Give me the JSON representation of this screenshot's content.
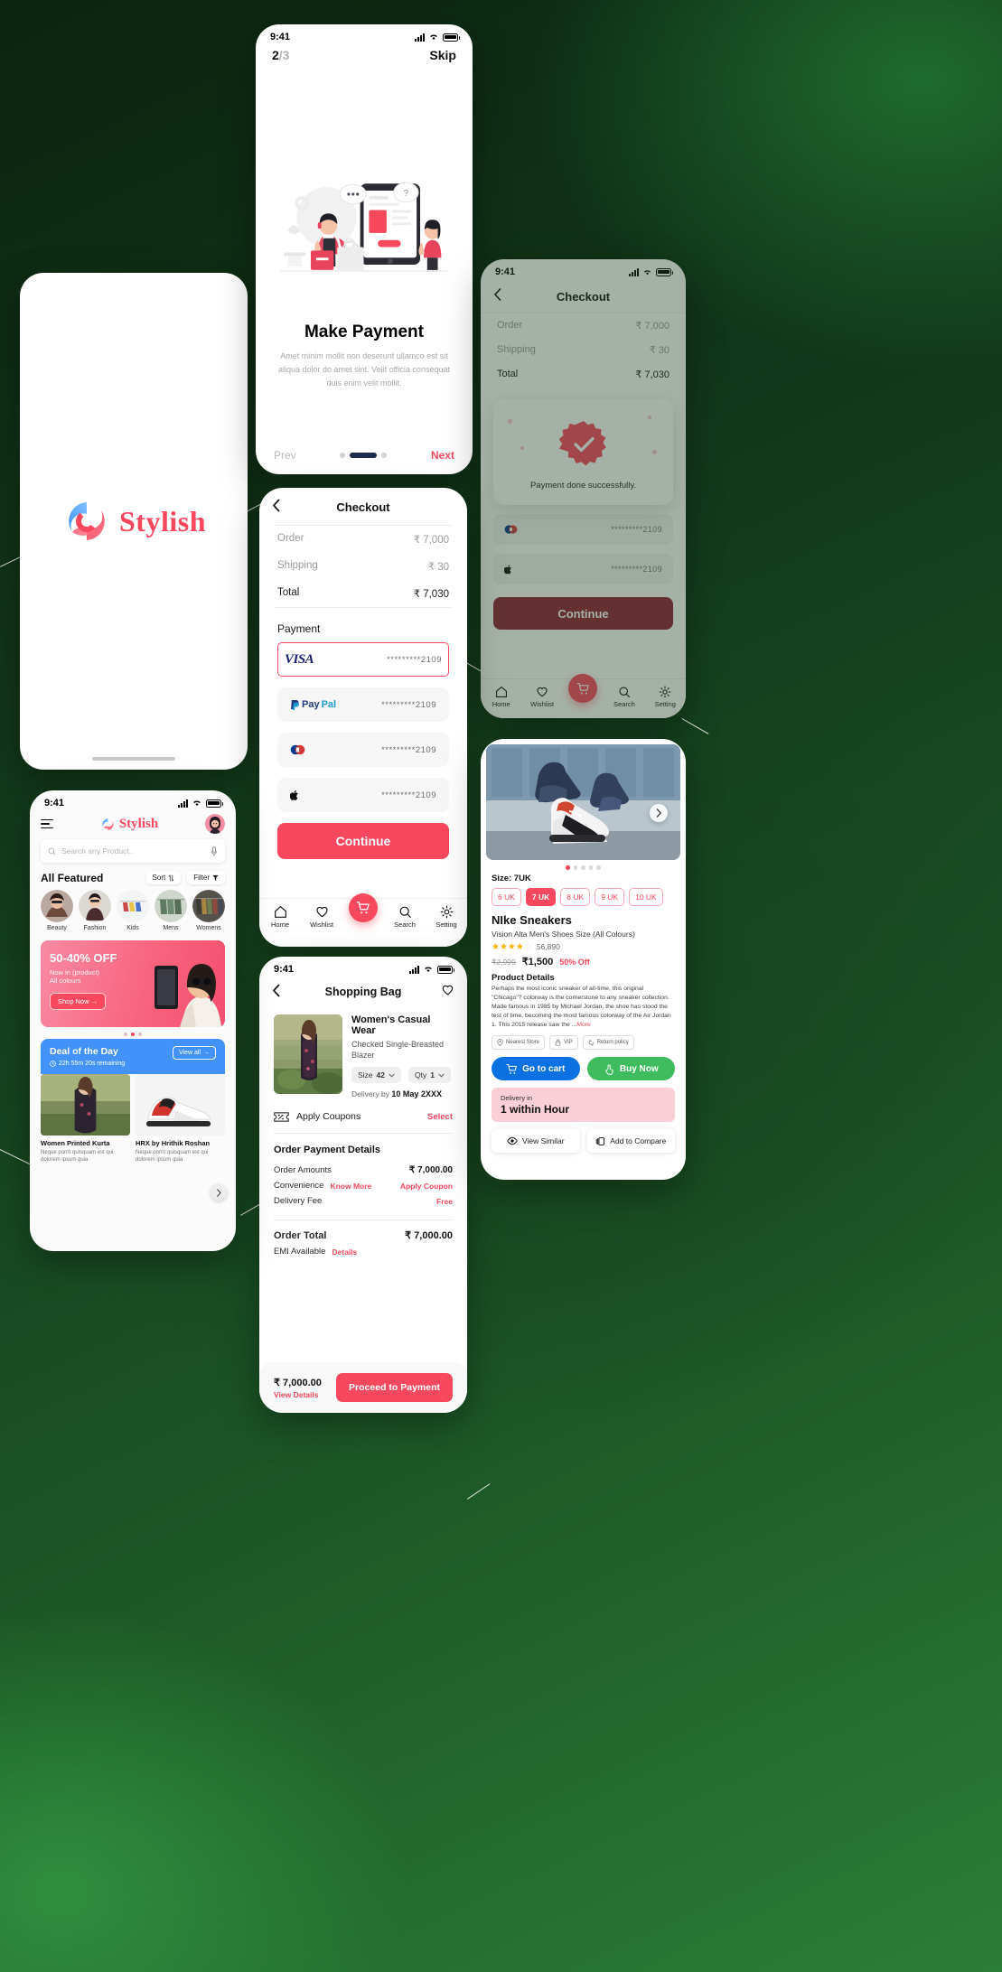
{
  "brand": {
    "name": "Stylish",
    "accent": "#F83758",
    "blue": "#4392F9",
    "green": "#3FBC5E"
  },
  "onboarding": {
    "time": "9:41",
    "step": "2",
    "step_total": "/3",
    "skip": "Skip",
    "title": "Make Payment",
    "subtitle": "Amet minim mollit non deserunt ullamco est sit aliqua dolor do amet sint. Velit officia consequat duis enim velit mollit.",
    "prev": "Prev",
    "next": "Next"
  },
  "checkout": {
    "title": "Checkout",
    "rows": [
      {
        "label": "Order",
        "value": "₹ 7,000"
      },
      {
        "label": "Shipping",
        "value": "₹   30"
      },
      {
        "label": "Total",
        "value": "₹ 7,030"
      }
    ],
    "payment_label": "Payment",
    "methods": [
      {
        "name": "VISA",
        "number": "*********2109",
        "selected": true
      },
      {
        "name": "PayPal",
        "number": "*********2109",
        "selected": false
      },
      {
        "name": "Maestro",
        "number": "*********2109",
        "selected": false
      },
      {
        "name": "ApplePay",
        "number": "*********2109",
        "selected": false
      }
    ],
    "continue": "Continue",
    "tabs": [
      {
        "label": "Home",
        "icon": "home-icon"
      },
      {
        "label": "Wishlist",
        "icon": "heart-icon"
      },
      {
        "label": "",
        "icon": "cart-icon"
      },
      {
        "label": "Search",
        "icon": "search-icon"
      },
      {
        "label": "Setting",
        "icon": "gear-icon"
      }
    ]
  },
  "payment_success": {
    "time": "9:41",
    "title": "Checkout",
    "rows": [
      {
        "label": "Order",
        "value": "₹ 7,000"
      },
      {
        "label": "Shipping",
        "value": "₹   30"
      },
      {
        "label": "Total",
        "value": "₹ 7,030"
      }
    ],
    "message": "Payment done successfully.",
    "methods": [
      {
        "name": "Maestro",
        "number": "*********2109"
      },
      {
        "name": "ApplePay",
        "number": "*********2109"
      }
    ],
    "continue": "Continue",
    "tabs": [
      {
        "label": "Home"
      },
      {
        "label": "Wishlist"
      },
      {
        "label": ""
      },
      {
        "label": "Search"
      },
      {
        "label": "Setting"
      }
    ]
  },
  "bag": {
    "time": "9:41",
    "title": "Shopping Bag",
    "item": {
      "name": "Women's Casual Wear",
      "desc": "Checked Single-Breasted Blazer",
      "size_label": "Size",
      "size_value": "42",
      "qty_label": "Qty",
      "qty_value": "1",
      "delivery_label": "Delivery by",
      "delivery_date": "10 May 2XXX"
    },
    "coupon_label": "Apply Coupons",
    "coupon_action": "Select",
    "details_title": "Order Payment Details",
    "details": [
      {
        "label": "Order Amounts",
        "sub": "",
        "value": "₹ 7,000.00",
        "value_accent": false
      },
      {
        "label": "Convenience",
        "sub": "Know More",
        "value": "Apply Coupon",
        "value_accent": true
      },
      {
        "label": "Delivery Fee",
        "sub": "",
        "value": "Free",
        "value_accent": true
      }
    ],
    "total_label": "Order Total",
    "total_value": "₹ 7,000.00",
    "emi_label": "EMI Available",
    "emi_action": "Details",
    "footer_amount": "₹ 7,000.00",
    "footer_link": "View Details",
    "footer_button": "Proceed to Payment"
  },
  "home": {
    "time": "9:41",
    "brand": "Stylish",
    "search_placeholder": "Search any Product..",
    "featured_title": "All Featured",
    "sort": "Sort",
    "filter": "Filter",
    "categories": [
      {
        "name": "Beauty"
      },
      {
        "name": "Fashion"
      },
      {
        "name": "Kids"
      },
      {
        "name": "Mens"
      },
      {
        "name": "Womens"
      }
    ],
    "promo": {
      "title": "50-40% OFF",
      "line1": "Now in (product)",
      "line2": "All colours",
      "button": "Shop Now"
    },
    "deal": {
      "title": "Deal of the Day",
      "timer": "22h 55m 20s remaining",
      "view_all": "View all"
    },
    "products": [
      {
        "name": "Women Printed Kurta",
        "desc": "Neque porro quisquam est qui dolorem ipsum quia"
      },
      {
        "name": "HRX by Hrithik Roshan",
        "desc": "Neque porro quisquam est qui dolorem ipsum quia"
      }
    ]
  },
  "product": {
    "size_label": "Size: 7UK",
    "sizes": [
      "6 UK",
      "7 UK",
      "8 UK",
      "9 UK",
      "10 UK"
    ],
    "selected_size": "7 UK",
    "title": "NIke Sneakers",
    "subtitle": "Vision Alta Men's Shoes Size (All Colours)",
    "stars": "★★★★",
    "half_star": "☆",
    "rating_count": "56,890",
    "price_old": "₹2,999",
    "price_new": "₹1,500",
    "discount": "50% Off",
    "details_title": "Product Details",
    "details_body": "Perhaps the most iconic sneaker of all-time, this original \"Chicago\"? colorway is the cornerstone to any sneaker collection. Made famous in 1985 by Michael Jordan, the shoe has stood the test of time, becoming the most famous colorway of the Air Jordan 1. This 2015 release saw the ...",
    "details_more": "More",
    "badges": [
      {
        "label": "Nearest Store",
        "icon": "location-icon"
      },
      {
        "label": "VIP",
        "icon": "lock-icon"
      },
      {
        "label": "Return policy",
        "icon": "return-icon"
      }
    ],
    "cart_button": "Go to cart",
    "buy_button": "Buy Now",
    "delivery_label": "Delivery in",
    "delivery_value": "1 within Hour",
    "view_similar": "View Similar",
    "add_compare": "Add to Compare"
  }
}
